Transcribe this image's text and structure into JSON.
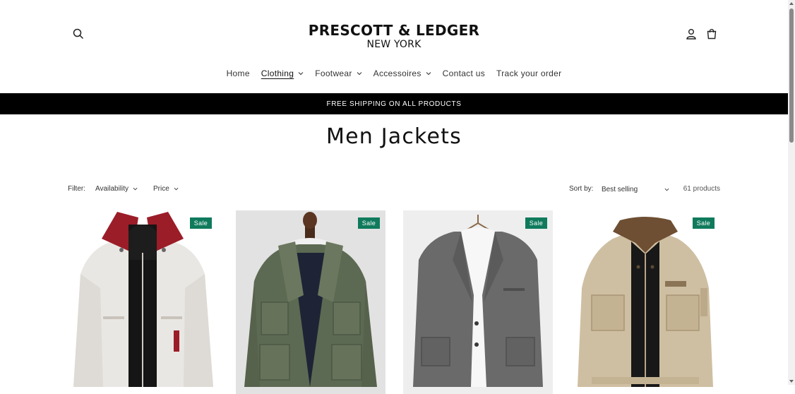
{
  "brand": {
    "name": "PRESCOTT & LEDGER",
    "sub": "NEW YORK"
  },
  "header": {
    "icons": [
      "search-icon",
      "account-icon",
      "cart-icon"
    ]
  },
  "nav": {
    "items": [
      {
        "label": "Home",
        "dropdown": false,
        "active": false
      },
      {
        "label": "Clothing",
        "dropdown": true,
        "active": true
      },
      {
        "label": "Footwear",
        "dropdown": true,
        "active": false
      },
      {
        "label": "Accessoires",
        "dropdown": true,
        "active": false
      },
      {
        "label": "Contact us",
        "dropdown": false,
        "active": false
      },
      {
        "label": "Track your order",
        "dropdown": false,
        "active": false
      }
    ]
  },
  "banner": {
    "text": "FREE SHIPPING ON ALL PRODUCTS"
  },
  "page": {
    "title": "Men Jackets"
  },
  "filters": {
    "label": "Filter:",
    "availability": "Availability",
    "price": "Price",
    "sort_label": "Sort by:",
    "sort_value": "Best selling",
    "count": "61 products"
  },
  "products": [
    {
      "badge": "Sale",
      "image": "white-harrington-jacket-red-collar"
    },
    {
      "badge": "Sale",
      "image": "olive-field-jacket-on-mannequin"
    },
    {
      "badge": "Sale",
      "image": "grey-linen-blazer-on-hanger"
    },
    {
      "badge": "Sale",
      "image": "beige-utility-jacket-brown-collar"
    }
  ],
  "colors": {
    "accent_badge": "#0f7a5c",
    "banner_bg": "#000000"
  }
}
